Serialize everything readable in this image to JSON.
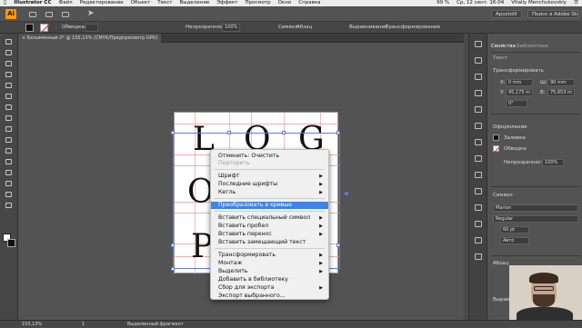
{
  "menubar": {
    "app_name": "Illustrator CC",
    "items": [
      "Файл",
      "Редактирование",
      "Объект",
      "Текст",
      "Выделение",
      "Эффект",
      "Просмотр",
      "Окно",
      "Справка"
    ],
    "battery": "99 %",
    "clock": "Ср, 12 сент. 16:04",
    "user": "Vitaliy Menchukovskiy"
  },
  "appbar": {
    "logo": "Ai",
    "workspace": "Apostolll",
    "search_placeholder": "Поиск в Adobe Stock"
  },
  "control_bar": {
    "stroke_label": "Обводка:",
    "opacity_label": "Непрозрачность:",
    "opacity_value": "100%",
    "symbol_label": "Символ",
    "paragraph_label": "Абзац",
    "align_label": "Выравнивание",
    "transform_label": "Трансформирование"
  },
  "document_tab": {
    "title": "Безымянный-2* @ 155,13% (CMYK/Предпросмотр GPU)"
  },
  "artboard": {
    "letters": [
      "L",
      "O",
      "G",
      "O",
      "P"
    ]
  },
  "context_menu": {
    "items": [
      {
        "label": "Отменить: Очистить",
        "disabled": false,
        "submenu": false
      },
      {
        "label": "Повторить",
        "disabled": true,
        "submenu": false
      },
      {
        "label": "Шрифт",
        "disabled": false,
        "submenu": true
      },
      {
        "label": "Последние шрифты",
        "disabled": false,
        "submenu": true
      },
      {
        "label": "Кегль",
        "disabled": false,
        "submenu": true
      },
      {
        "label": "Преобразовать в кривые",
        "disabled": false,
        "submenu": false,
        "highlighted": true
      },
      {
        "label": "Вставить специальный символ",
        "disabled": false,
        "submenu": true
      },
      {
        "label": "Вставить пробел",
        "disabled": false,
        "submenu": true
      },
      {
        "label": "Вставить перенос",
        "disabled": false,
        "submenu": true
      },
      {
        "label": "Вставить замещающий текст",
        "disabled": false,
        "submenu": false
      },
      {
        "label": "Трансформировать",
        "disabled": false,
        "submenu": true
      },
      {
        "label": "Монтаж",
        "disabled": false,
        "submenu": true
      },
      {
        "label": "Выделить",
        "disabled": false,
        "submenu": true
      },
      {
        "label": "Добавить в библиотеку",
        "disabled": false,
        "submenu": false
      },
      {
        "label": "Сбор для экспорта",
        "disabled": false,
        "submenu": true
      },
      {
        "label": "Экспорт выбранного...",
        "disabled": false,
        "submenu": false
      }
    ]
  },
  "status_bar": {
    "zoom": "155,13%",
    "page": "1",
    "tool_info": "Выделенный фрагмент"
  },
  "properties_panel": {
    "tabs": [
      "Свойства",
      "Библиотеки"
    ],
    "section_text": "Текст",
    "transform": {
      "title": "Трансформировать",
      "x_label": "X:",
      "x_value": "0 mm",
      "y_label": "Y:",
      "y_value": "45,175 m",
      "w_label": "Ш:",
      "w_value": "90 mm",
      "h_label": "В:",
      "h_value": "75,653 m",
      "angle_value": "0°"
    },
    "appearance": {
      "title": "Оформление",
      "fill_label": "Заливка",
      "stroke_label": "Обводка",
      "opacity_label": "Непрозрачность",
      "opacity_value": "100%"
    },
    "symbol": {
      "title": "Символ",
      "font": "Marion",
      "style": "Regular",
      "size": "60 pt",
      "leading": "Авто"
    },
    "paragraph_title": "Абзац",
    "align_title": "Выравн"
  },
  "colors": {
    "highlight": "#3f84e5",
    "logo_bg": "#ff9a00",
    "guide": "#f08a8a",
    "selection": "#5a7be8"
  }
}
